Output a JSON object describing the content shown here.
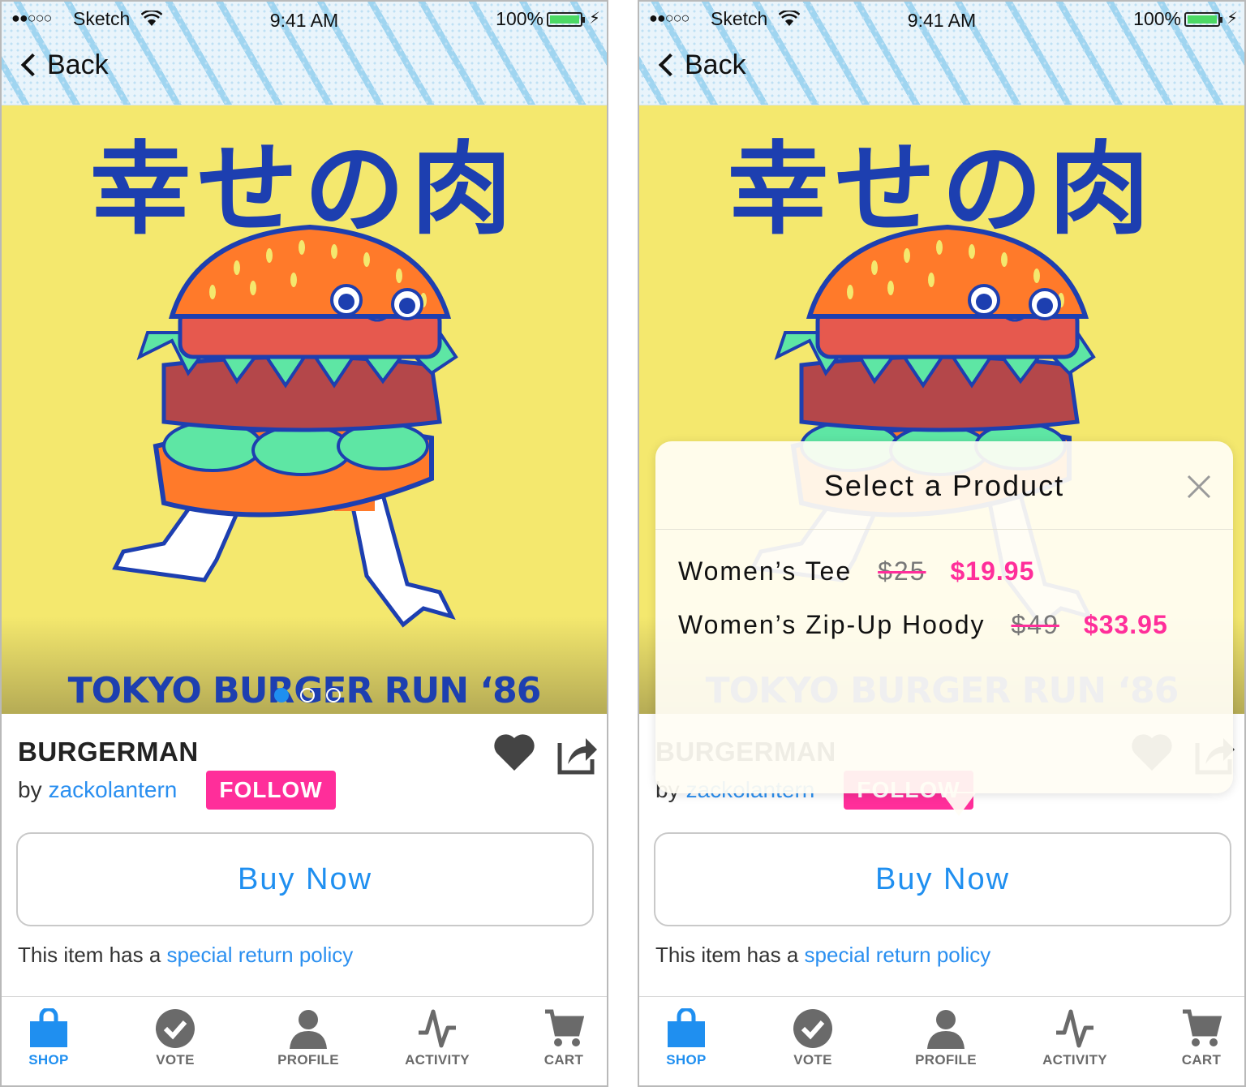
{
  "status_bar": {
    "signal": "●●○○○",
    "carrier": "Sketch",
    "time": "9:41 AM",
    "battery_percent": "100%"
  },
  "nav": {
    "back_label": "Back"
  },
  "hero": {
    "jp_title": "幸せの肉",
    "caption": "TOKYO BURGER RUN ‘86",
    "page_count": 3,
    "active_page": 1
  },
  "product": {
    "title": "BURGERMAN",
    "by": "by",
    "artist": "zackolantern",
    "follow_label": "FOLLOW",
    "buy_label": "Buy Now",
    "return_prefix": "This item has a",
    "return_link": "special return policy"
  },
  "tabs": [
    {
      "label": "SHOP",
      "icon": "shopping-bag-icon",
      "active": true
    },
    {
      "label": "VOTE",
      "icon": "checkmark-circle-icon",
      "active": false
    },
    {
      "label": "PROFILE",
      "icon": "person-icon",
      "active": false
    },
    {
      "label": "ACTIVITY",
      "icon": "activity-pulse-icon",
      "active": false
    },
    {
      "label": "CART",
      "icon": "cart-icon",
      "active": false
    }
  ],
  "popover": {
    "title": "Select a Product",
    "items": [
      {
        "name": "Women’s Tee",
        "old_price": "$25",
        "new_price": "$19.95"
      },
      {
        "name": "Women’s Zip-Up Hoody",
        "old_price": "$49",
        "new_price": "$33.95"
      }
    ]
  },
  "colors": {
    "accent_blue": "#1f8ff0",
    "accent_pink": "#ff2e9a",
    "hero_yellow": "#f4e86e",
    "art_blue": "#1d3fb0"
  }
}
